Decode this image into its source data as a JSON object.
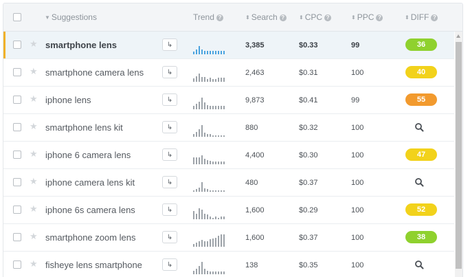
{
  "header": {
    "suggestions": "Suggestions",
    "trend": "Trend",
    "search": "Search",
    "cpc": "CPC",
    "ppc": "PPC",
    "diff": "DIFF"
  },
  "colors": {
    "diff_green": "#8fd12e",
    "diff_yellow": "#f2d21b",
    "diff_orange": "#f29a2e",
    "active_marker": "#f0b128",
    "active_trend": "#4aa3df"
  },
  "rows": [
    {
      "keyword": "smartphone lens",
      "search": "3,385",
      "cpc": "$0.33",
      "ppc": "99",
      "diff": "36",
      "diff_level": "green",
      "selected": true,
      "trend": [
        3,
        6,
        10,
        6,
        4,
        4,
        4,
        4,
        4,
        4,
        4,
        4
      ]
    },
    {
      "keyword": "smartphone camera lens",
      "search": "2,463",
      "cpc": "$0.31",
      "ppc": "100",
      "diff": "40",
      "diff_level": "yellow",
      "trend": [
        4,
        7,
        10,
        6,
        6,
        3,
        5,
        3,
        3,
        5,
        5,
        5
      ]
    },
    {
      "keyword": "iphone lens",
      "search": "9,873",
      "cpc": "$0.41",
      "ppc": "99",
      "diff": "55",
      "diff_level": "orange",
      "trend": [
        4,
        7,
        9,
        14,
        8,
        5,
        4,
        4,
        4,
        4,
        4,
        4
      ]
    },
    {
      "keyword": "smartphone lens kit",
      "search": "880",
      "cpc": "$0.32",
      "ppc": "100",
      "diff": "",
      "trend": [
        3,
        6,
        9,
        14,
        5,
        3,
        3,
        2,
        2,
        2,
        2,
        2
      ]
    },
    {
      "keyword": "iphone 6 camera lens",
      "search": "4,400",
      "cpc": "$0.30",
      "ppc": "100",
      "diff": "47",
      "diff_level": "yellow",
      "trend": [
        8,
        8,
        8,
        11,
        7,
        5,
        4,
        3,
        3,
        3,
        3,
        3
      ]
    },
    {
      "keyword": "iphone camera lens kit",
      "search": "480",
      "cpc": "$0.37",
      "ppc": "100",
      "diff": "",
      "trend": [
        2,
        3,
        5,
        12,
        4,
        3,
        2,
        2,
        2,
        2,
        2,
        2
      ]
    },
    {
      "keyword": "iphone 6s camera lens",
      "search": "1,600",
      "cpc": "$0.29",
      "ppc": "100",
      "diff": "52",
      "diff_level": "yellow",
      "trend": [
        10,
        7,
        13,
        12,
        7,
        6,
        3,
        2,
        3,
        2,
        3,
        3
      ]
    },
    {
      "keyword": "smartphone zoom lens",
      "search": "1,600",
      "cpc": "$0.37",
      "ppc": "100",
      "diff": "38",
      "diff_level": "green",
      "trend": [
        3,
        5,
        7,
        8,
        7,
        7,
        9,
        10,
        11,
        13,
        15,
        15
      ]
    },
    {
      "keyword": "fisheye lens smartphone",
      "search": "138",
      "cpc": "$0.35",
      "ppc": "100",
      "diff": "",
      "trend": [
        4,
        7,
        10,
        15,
        7,
        4,
        3,
        3,
        3,
        3,
        3,
        3
      ]
    }
  ]
}
